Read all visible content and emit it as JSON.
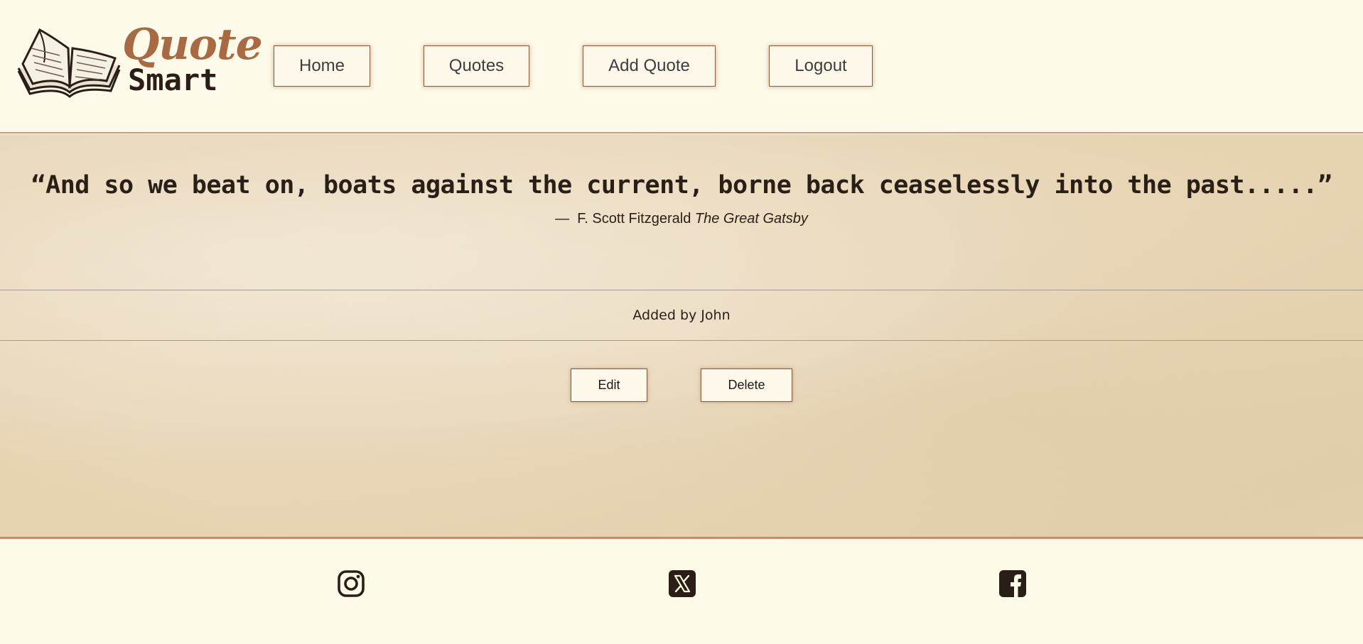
{
  "logo": {
    "line1": "Quote",
    "line2": "Smart"
  },
  "nav": {
    "home": "Home",
    "quotes": "Quotes",
    "add_quote": "Add Quote",
    "logout": "Logout"
  },
  "quote": {
    "text": "“And so we beat on, boats against the current, borne back ceaselessly into the past.....”",
    "dash": "—",
    "author": "F. Scott Fitzgerald",
    "book": "The Great Gatsby",
    "added_by": "Added by John"
  },
  "actions": {
    "edit": "Edit",
    "delete": "Delete"
  },
  "footer": {
    "icons": [
      "instagram-icon",
      "x-twitter-icon",
      "facebook-icon"
    ]
  },
  "colors": {
    "background": "#fdfaea",
    "accent": "#a86a42",
    "text": "#2a1f16",
    "border": "#8a5a3c"
  }
}
